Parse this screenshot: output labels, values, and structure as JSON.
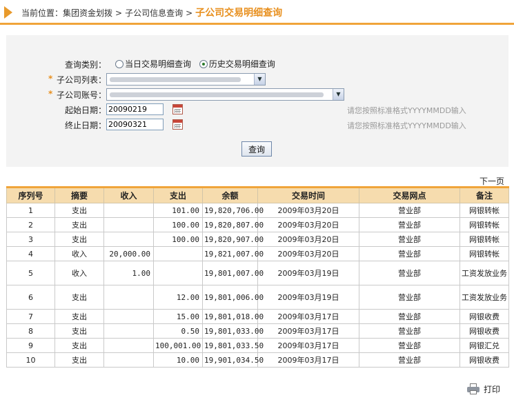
{
  "breadcrumb": {
    "prefix": "当前位置：",
    "items": [
      "集团资金划拨",
      "子公司信息查询"
    ],
    "separator": ">",
    "current": "子公司交易明细查询"
  },
  "form": {
    "query_type_label": "查询类别：",
    "radio_today": "当日交易明细查询",
    "radio_history": "历史交易明细查询",
    "selected": "history",
    "required_mark": "*",
    "company_list_label": "子公司列表：",
    "company_account_label": "子公司账号：",
    "start_date_label": "起始日期：",
    "start_date_value": "20090219",
    "end_date_label": "终止日期：",
    "end_date_value": "20090321",
    "date_hint": "请您按照标准格式YYYYMMDD输入",
    "submit_label": "查询"
  },
  "next_page": "下一页",
  "table": {
    "headers": [
      "序列号",
      "摘要",
      "收入",
      "支出",
      "余额",
      "交易时间",
      "交易网点",
      "备注"
    ],
    "rows": [
      [
        "1",
        "支出",
        "",
        "101.00",
        "19,820,706.00",
        "2009年03月20日",
        "营业部",
        "网银转帐"
      ],
      [
        "2",
        "支出",
        "",
        "100.00",
        "19,820,807.00",
        "2009年03月20日",
        "营业部",
        "网银转帐"
      ],
      [
        "3",
        "支出",
        "",
        "100.00",
        "19,820,907.00",
        "2009年03月20日",
        "营业部",
        "网银转帐"
      ],
      [
        "4",
        "收入",
        "20,000.00",
        "",
        "19,821,007.00",
        "2009年03月20日",
        "营业部",
        "网银转帐"
      ],
      [
        "5",
        "收入",
        "1.00",
        "",
        "19,801,007.00",
        "2009年03月19日",
        "营业部",
        "工资发放业务"
      ],
      [
        "6",
        "支出",
        "",
        "12.00",
        "19,801,006.00",
        "2009年03月19日",
        "营业部",
        "工资发放业务"
      ],
      [
        "7",
        "支出",
        "",
        "15.00",
        "19,801,018.00",
        "2009年03月17日",
        "营业部",
        "网银收费"
      ],
      [
        "8",
        "支出",
        "",
        "0.50",
        "19,801,033.00",
        "2009年03月17日",
        "营业部",
        "网银收费"
      ],
      [
        "9",
        "支出",
        "",
        "100,001.00",
        "19,801,033.50",
        "2009年03月17日",
        "营业部",
        "网银汇兑"
      ],
      [
        "10",
        "支出",
        "",
        "10.00",
        "19,901,034.50",
        "2009年03月17日",
        "营业部",
        "网银收费"
      ]
    ]
  },
  "print_label": "打印",
  "colors": {
    "accent": "#f0a43a",
    "header_bg": "#f6dcae",
    "panel_bg": "#f3f3f3"
  }
}
